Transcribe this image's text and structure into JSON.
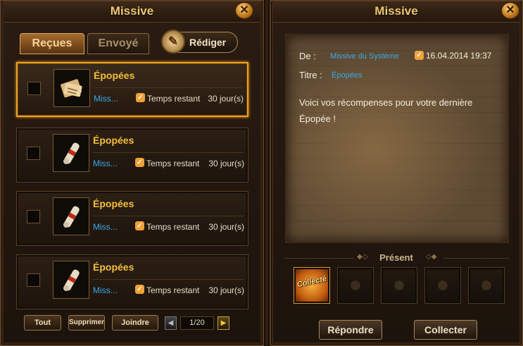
{
  "inbox": {
    "title": "Missive",
    "tabs": [
      {
        "label": "Reçues"
      },
      {
        "label": "Envoyé"
      }
    ],
    "compose_label": "Rédiger",
    "items": [
      {
        "subject": "Épopées",
        "sender": "Miss...",
        "time_label": "Temps restant",
        "time_value": "30 jour(s)",
        "icon": "scroll-map-icon"
      },
      {
        "subject": "Épopées",
        "sender": "Miss...",
        "time_label": "Temps restant",
        "time_value": "30 jour(s)",
        "icon": "scroll-icon"
      },
      {
        "subject": "Épopées",
        "sender": "Miss...",
        "time_label": "Temps restant",
        "time_value": "30 jour(s)",
        "icon": "scroll-icon"
      },
      {
        "subject": "Épopées",
        "sender": "Miss...",
        "time_label": "Temps restant",
        "time_value": "30 jour(s)",
        "icon": "scroll-icon"
      }
    ],
    "buttons": {
      "all": "Tout",
      "delete": "Supprimer",
      "attach": "Joindre"
    },
    "pagination": {
      "indicator": "1/20"
    }
  },
  "reader": {
    "title": "Missive",
    "from_label": "De :",
    "from_value": "Missive du Système",
    "date": "16.04.2014 19:37",
    "subject_label": "Titre :",
    "subject_value": "Épopées",
    "body": "Voici vos récompenses pour votre dernière Épopée !",
    "present_title": "Présent",
    "present_slots": [
      {
        "label": "Collecté"
      }
    ],
    "reply_label": "Répondre",
    "collect_label": "Collecter"
  },
  "colors": {
    "accent_gold": "#f0a020",
    "subject_yellow": "#f5bf3e",
    "link_blue": "#3aa8e8",
    "title_gold": "#f0c673"
  }
}
